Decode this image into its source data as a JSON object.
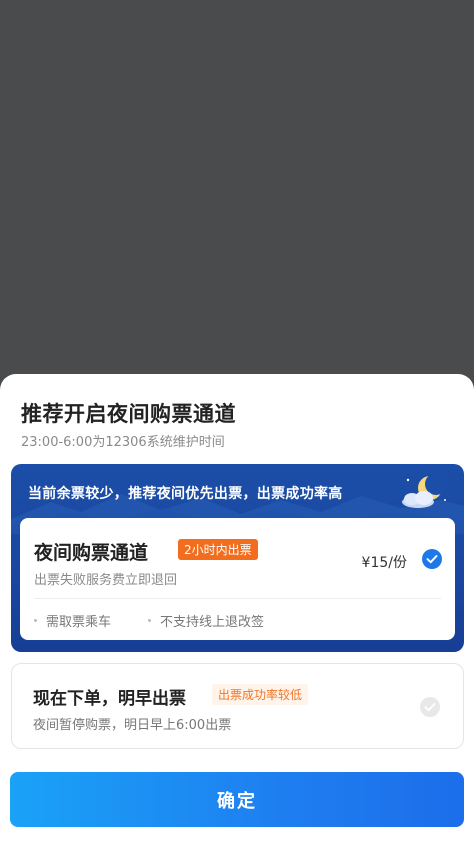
{
  "sheet": {
    "title": "推荐开启夜间购票通道",
    "subtitle": "23:00-6:00为12306系统维护时间"
  },
  "night_option": {
    "banner": "当前余票较少，推荐夜间优先出票，出票成功率高",
    "title": "夜间购票通道",
    "badge": "2小时内出票",
    "description": "出票失败服务费立即退回",
    "price": "¥15/份",
    "selected": true,
    "tags": [
      "需取票乘车",
      "不支持线上退改签"
    ]
  },
  "morning_option": {
    "title": "现在下单，明早出票",
    "badge": "出票成功率较低",
    "description": "夜间暂停购票，明日早上6:00出票",
    "selected": false
  },
  "confirm_button": "确定",
  "colors": {
    "accent_blue": "#1e78e6",
    "badge_orange": "#f36d1f",
    "banner_blue": "#1b4ea8"
  }
}
